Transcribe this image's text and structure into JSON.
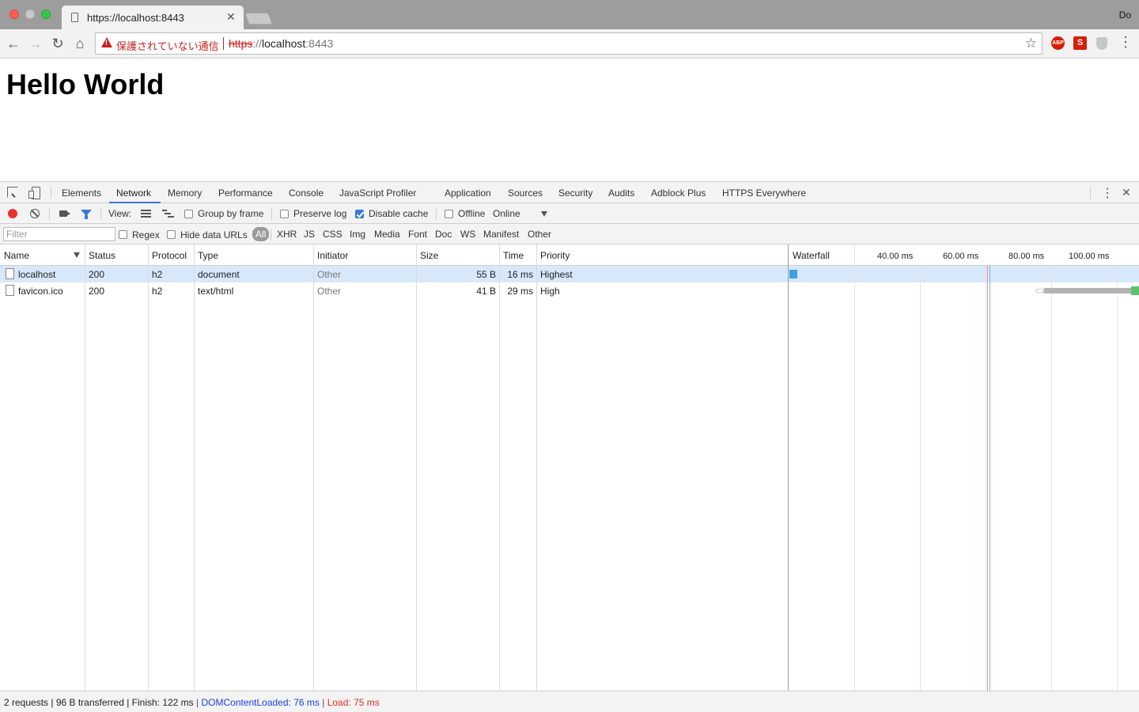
{
  "browser": {
    "tab_title": "https://localhost:8443",
    "profile_label": "Do",
    "security_text": "保護されていない通信",
    "url": {
      "scheme": "https",
      "separator": "://",
      "host": "localhost",
      "port": ":8443"
    }
  },
  "page": {
    "heading": "Hello World"
  },
  "devtools": {
    "tabs": [
      "Elements",
      "Network",
      "Memory",
      "Performance",
      "Console",
      "JavaScript Profiler",
      "Application",
      "Sources",
      "Security",
      "Audits",
      "Adblock Plus",
      "HTTPS Everywhere"
    ],
    "active_tab": "Network",
    "toolbar": {
      "view_label": "View:",
      "group_by_frame": "Group by frame",
      "preserve_log": "Preserve log",
      "disable_cache": "Disable cache",
      "offline": "Offline",
      "throttle": "Online"
    },
    "filter_bar": {
      "placeholder": "Filter",
      "regex": "Regex",
      "hide_data_urls": "Hide data URLs",
      "types": [
        "All",
        "XHR",
        "JS",
        "CSS",
        "Img",
        "Media",
        "Font",
        "Doc",
        "WS",
        "Manifest",
        "Other"
      ]
    },
    "columns": {
      "name": "Name",
      "status": "Status",
      "protocol": "Protocol",
      "type": "Type",
      "initiator": "Initiator",
      "size": "Size",
      "time": "Time",
      "priority": "Priority"
    },
    "rows": [
      {
        "name": "localhost",
        "status": "200",
        "protocol": "h2",
        "type": "document",
        "initiator": "Other",
        "size": "55 B",
        "time": "16 ms",
        "priority": "Highest"
      },
      {
        "name": "favicon.ico",
        "status": "200",
        "protocol": "h2",
        "type": "text/html",
        "initiator": "Other",
        "size": "41 B",
        "time": "29 ms",
        "priority": "High"
      }
    ],
    "waterfall": {
      "title": "Waterfall",
      "ticks": [
        "40.00 ms",
        "60.00 ms",
        "80.00 ms",
        "100.00 ms"
      ],
      "colors": {
        "localhost_bar": "#3f9de8",
        "favicon_wait": "#b3b3b3",
        "favicon_download": "#5bc46a",
        "dom_line": "#8fa8ee",
        "load_line": "#e79a9a"
      }
    },
    "status": {
      "summary": "2 requests | 96 B transferred | Finish: 122 ms",
      "sep": " | ",
      "dom": "DOMContentLoaded: 76 ms",
      "load": "Load: 75 ms"
    }
  }
}
